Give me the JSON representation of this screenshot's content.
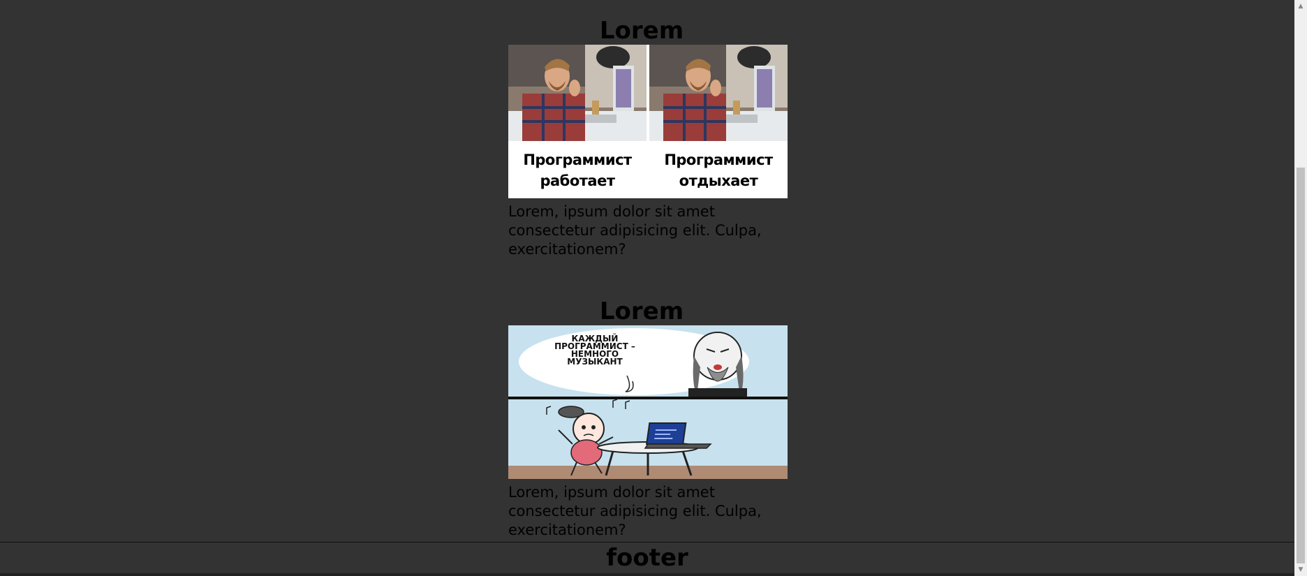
{
  "cards": [
    {
      "title": "Lorem",
      "caption_left_1": "Программист",
      "caption_left_2": "работает",
      "caption_right_1": "Программист",
      "caption_right_2": "отдыхает",
      "text": "Lorem, ipsum dolor sit amet consectetur adipisicing elit. Culpa, exercitationem?"
    },
    {
      "title": "Lorem",
      "speech_1": "КАЖДЫЙ",
      "speech_2": "ПРОГРАММИСТ –",
      "speech_3": "НЕМНОГО",
      "speech_4": "МУЗЫКАНТ",
      "text": "Lorem, ipsum dolor sit amet consectetur adipisicing elit. Culpa, exercitationem?"
    }
  ],
  "footer": {
    "label": "footer"
  }
}
